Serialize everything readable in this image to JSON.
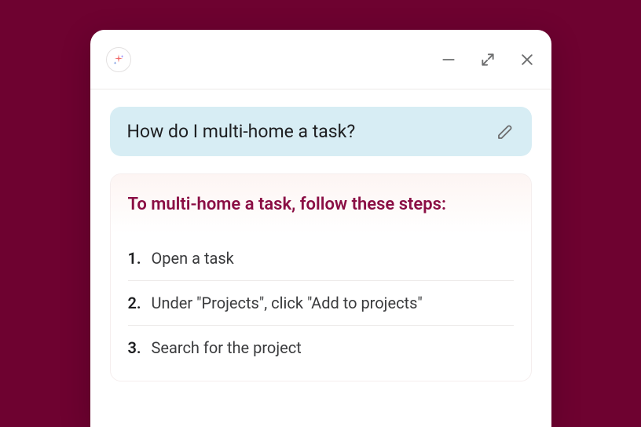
{
  "question": "How do I multi-home a task?",
  "answer": {
    "title": "To multi-home a task, follow these steps:",
    "steps": [
      "Open a task",
      "Under \"Projects\", click \"Add to projects\"",
      "Search for the project"
    ]
  }
}
